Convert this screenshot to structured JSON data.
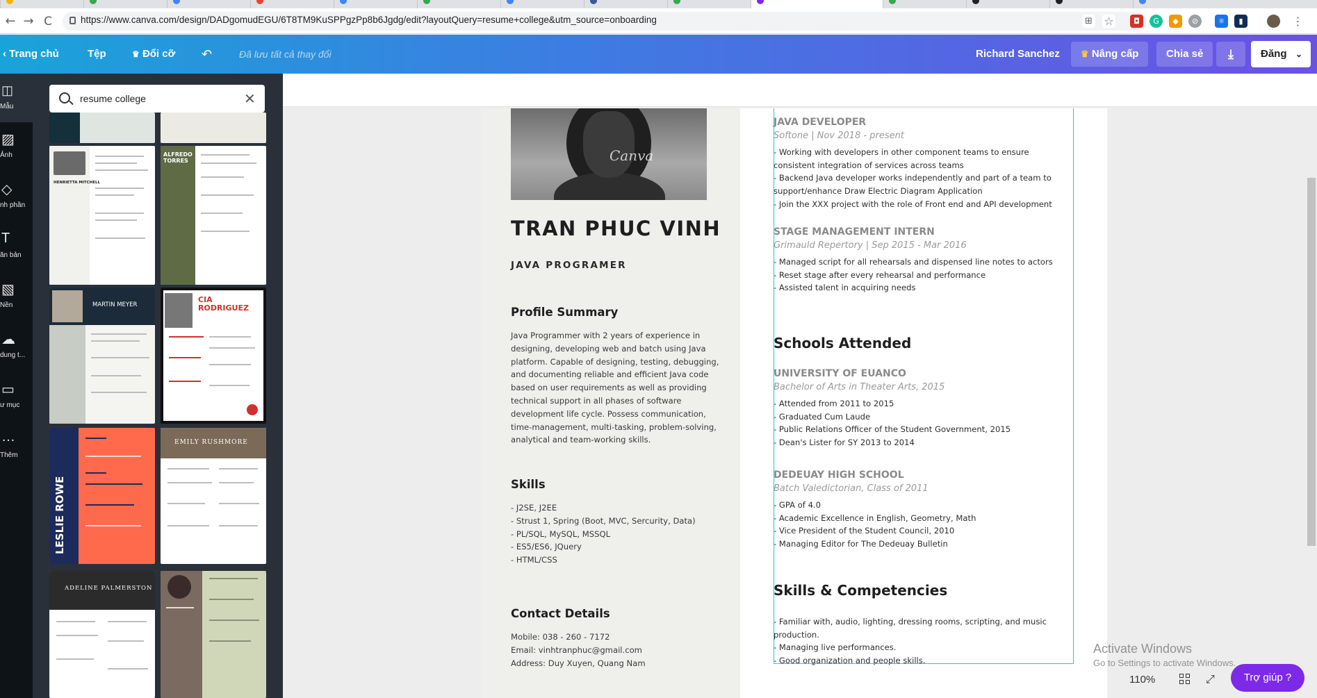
{
  "browser": {
    "url": "https://www.canva.com/design/DADgomudEGU/6T8TM9KuSPPgzPp8b6Jgdg/edit?layoutQuery=resume+college&utm_source=onboarding",
    "back": "←",
    "forward": "→",
    "reload": "C"
  },
  "header": {
    "home": "Trang chủ",
    "file": "Tệp",
    "resize": "Đổi cỡ",
    "saved_status": "Đã lưu tất cả thay đổi",
    "user": "Richard Sanchez",
    "upgrade": "Nâng cấp",
    "share": "Chia sẻ",
    "publish": "Đăng"
  },
  "rail": {
    "items": [
      "Mẫu",
      "Ảnh",
      "nh phần",
      "ăn bản",
      "Nền",
      "dung t...",
      "ư mục",
      "Thêm"
    ]
  },
  "panel": {
    "search_value": "resume college",
    "templates": [
      "MARTIN MEYER",
      "CIA RODRIGUEZ",
      "LESLIE ROWE",
      "EMILY RUSHMORE",
      "ADELINE PALMERSTON",
      "ALFREDO TORRES",
      "HENRIETTA MITCHELL"
    ]
  },
  "resume": {
    "watermark": "Canva",
    "name": "TRAN PHUC VINH",
    "role": "JAVA PROGRAMER",
    "profile_heading": "Profile Summary",
    "profile_lines": [
      "Java Programmer with 2 years of experience in",
      "designing, developing web and batch using Java",
      "platform. Capable of designing, testing, debugging,",
      "and documenting reliable and efficient Java code",
      "based on user requirements as well as providing",
      "technical support in all phases of software",
      "development life cycle. Possess communication,",
      "time-management, multi-tasking, problem-solving,",
      "analytical and team-working skills."
    ],
    "skills_heading": "Skills",
    "skills": [
      "- J2SE, J2EE",
      "- Strust 1, Spring (Boot, MVC, Sercurity, Data)",
      "- PL/SQL, MySQL, MSSQL",
      "- ES5/ES6,  JQuery",
      "- HTML/CSS"
    ],
    "contact_heading": "Contact Details",
    "contact": [
      "Mobile: 038 - 260 - 7172",
      "Email: vinhtranphuc@gmail.com",
      "Address: Duy Xuyen, Quang Nam"
    ],
    "jobs": [
      {
        "title": "JAVA DEVELOPER",
        "sub": "Softone | Nov 2018 - present",
        "lines": [
          "- Working with developers in other component teams to ensure",
          "consistent integration of services across teams",
          "- Backend Java developer works independently and part of a team to",
          "support/enhance Draw Electric Diagram Application",
          "- Join the XXX project with the role of Front end and API development"
        ]
      },
      {
        "title": "STAGE MANAGEMENT INTERN",
        "sub": "Grimauld Repertory | Sep 2015 - Mar 2016",
        "lines": [
          "- Managed script for all rehearsals and dispensed line notes to actors",
          "- Reset stage after every rehearsal and performance",
          "- Assisted talent in acquiring needs"
        ]
      }
    ],
    "schools_heading": "Schools Attended",
    "schools": [
      {
        "title": "UNIVERSITY OF EUANCO",
        "sub": "Bachelor of Arts in Theater Arts, 2015",
        "lines": [
          "- Attended from 2011 to 2015",
          "- Graduated Cum Laude",
          "- Public Relations Officer of the Student Government, 2015",
          "- Dean's Lister for SY 2013 to 2014"
        ]
      },
      {
        "title": "DEDEUAY HIGH SCHOOL",
        "sub": "Batch Valedictorian, Class of 2011",
        "lines": [
          "- GPA of 4.0",
          "- Academic Excellence in English, Geometry, Math",
          "- Vice President of the Student Council, 2010",
          "- Managing Editor for The Dedeuay Bulletin"
        ]
      }
    ],
    "competencies_heading": "Skills & Competencies",
    "competencies": [
      "- Familiar with, audio, lighting, dressing rooms, scripting, and music",
      "production.",
      "- Managing live performances.",
      "- Good organization and people skills."
    ]
  },
  "footer": {
    "activate_title": "Activate Windows",
    "activate_sub": "Go to Settings to activate Windows.",
    "zoom": "110%",
    "help": "Trợ giúp ?"
  },
  "colors": {
    "header_gradient_start": "#1aa3d9",
    "header_gradient_end": "#6b51e4",
    "rail": "#0e1318",
    "panel": "#293039",
    "selection": "#32c4d4",
    "help": "#7d2ae8"
  }
}
